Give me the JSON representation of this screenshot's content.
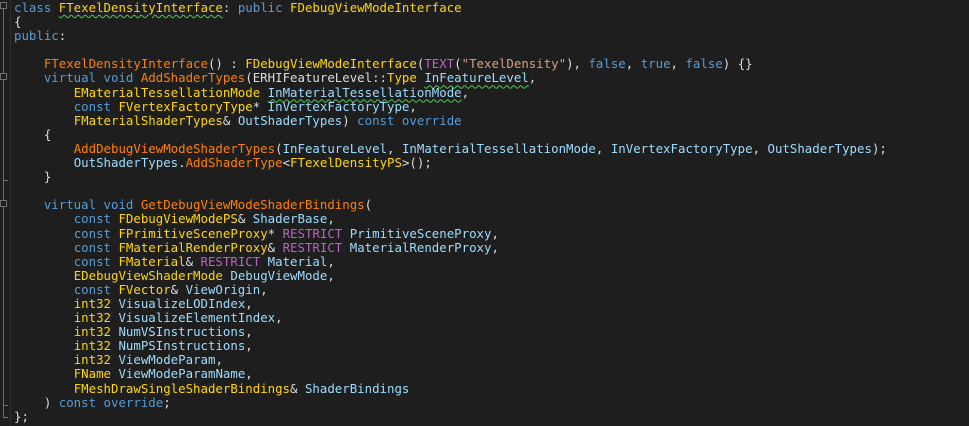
{
  "editor": {
    "lines": [
      [
        {
          "c": "k",
          "t": "class "
        },
        {
          "c": "t",
          "t": "FTexelDensityInterface",
          "sq": "true"
        },
        {
          "c": "pl",
          "t": ": "
        },
        {
          "c": "k",
          "t": "public "
        },
        {
          "c": "t",
          "t": "FDebugViewModeInterface"
        }
      ],
      [
        {
          "c": "pl",
          "t": "{"
        }
      ],
      [
        {
          "c": "k",
          "t": "public"
        },
        {
          "c": "pl",
          "t": ":"
        }
      ],
      [],
      [
        {
          "c": "pl",
          "t": "    "
        },
        {
          "c": "f",
          "t": "FTexelDensityInterface"
        },
        {
          "c": "pl",
          "t": "() : "
        },
        {
          "c": "t",
          "t": "FDebugViewModeInterface"
        },
        {
          "c": "pl",
          "t": "("
        },
        {
          "c": "m",
          "t": "TEXT"
        },
        {
          "c": "pl",
          "t": "("
        },
        {
          "c": "s",
          "t": "\"TexelDensity\""
        },
        {
          "c": "pl",
          "t": "), "
        },
        {
          "c": "k",
          "t": "false"
        },
        {
          "c": "pl",
          "t": ", "
        },
        {
          "c": "k",
          "t": "true"
        },
        {
          "c": "pl",
          "t": ", "
        },
        {
          "c": "k",
          "t": "false"
        },
        {
          "c": "pl",
          "t": ") {}"
        }
      ],
      [
        {
          "c": "pl",
          "t": "    "
        },
        {
          "c": "k",
          "t": "virtual void "
        },
        {
          "c": "f",
          "t": "AddShaderTypes"
        },
        {
          "c": "pl",
          "t": "(ERHIFeatureLevel::"
        },
        {
          "c": "t",
          "t": "Type"
        },
        {
          "c": "pl",
          "t": " "
        },
        {
          "c": "p",
          "t": "InFeatureLevel",
          "sq": "true"
        },
        {
          "c": "pl",
          "t": ","
        }
      ],
      [
        {
          "c": "pl",
          "t": "        "
        },
        {
          "c": "t",
          "t": "EMaterialTessellationMode"
        },
        {
          "c": "pl",
          "t": " "
        },
        {
          "c": "p",
          "t": "InMaterialTessellationMode",
          "sq": "true"
        },
        {
          "c": "pl",
          "t": ","
        }
      ],
      [
        {
          "c": "pl",
          "t": "        "
        },
        {
          "c": "k",
          "t": "const "
        },
        {
          "c": "t",
          "t": "FVertexFactoryType"
        },
        {
          "c": "pl",
          "t": "* "
        },
        {
          "c": "p",
          "t": "InVertexFactoryType"
        },
        {
          "c": "pl",
          "t": ","
        }
      ],
      [
        {
          "c": "pl",
          "t": "        "
        },
        {
          "c": "t",
          "t": "FMaterialShaderTypes"
        },
        {
          "c": "pl",
          "t": "& "
        },
        {
          "c": "p",
          "t": "OutShaderTypes"
        },
        {
          "c": "pl",
          "t": ") "
        },
        {
          "c": "k",
          "t": "const override"
        }
      ],
      [
        {
          "c": "pl",
          "t": "    {"
        }
      ],
      [
        {
          "c": "pl",
          "t": "        "
        },
        {
          "c": "f",
          "t": "AddDebugViewModeShaderTypes"
        },
        {
          "c": "pl",
          "t": "("
        },
        {
          "c": "p",
          "t": "InFeatureLevel"
        },
        {
          "c": "pl",
          "t": ", "
        },
        {
          "c": "p",
          "t": "InMaterialTessellationMode"
        },
        {
          "c": "pl",
          "t": ", "
        },
        {
          "c": "p",
          "t": "InVertexFactoryType"
        },
        {
          "c": "pl",
          "t": ", "
        },
        {
          "c": "p",
          "t": "OutShaderTypes"
        },
        {
          "c": "pl",
          "t": ");"
        }
      ],
      [
        {
          "c": "pl",
          "t": "        "
        },
        {
          "c": "p",
          "t": "OutShaderTypes"
        },
        {
          "c": "pl",
          "t": "."
        },
        {
          "c": "f",
          "t": "AddShaderType"
        },
        {
          "c": "pl",
          "t": "<"
        },
        {
          "c": "t",
          "t": "FTexelDensityPS"
        },
        {
          "c": "pl",
          "t": ">();"
        }
      ],
      [
        {
          "c": "pl",
          "t": "    }"
        }
      ],
      [],
      [
        {
          "c": "pl",
          "t": "    "
        },
        {
          "c": "k",
          "t": "virtual void "
        },
        {
          "c": "f",
          "t": "GetDebugViewModeShaderBindings"
        },
        {
          "c": "pl",
          "t": "("
        }
      ],
      [
        {
          "c": "pl",
          "t": "        "
        },
        {
          "c": "k",
          "t": "const "
        },
        {
          "c": "t",
          "t": "FDebugViewModePS"
        },
        {
          "c": "pl",
          "t": "& "
        },
        {
          "c": "p",
          "t": "ShaderBase"
        },
        {
          "c": "pl",
          "t": ","
        }
      ],
      [
        {
          "c": "pl",
          "t": "        "
        },
        {
          "c": "k",
          "t": "const "
        },
        {
          "c": "t",
          "t": "FPrimitiveSceneProxy"
        },
        {
          "c": "pl",
          "t": "* "
        },
        {
          "c": "m",
          "t": "RESTRICT"
        },
        {
          "c": "pl",
          "t": " "
        },
        {
          "c": "p",
          "t": "PrimitiveSceneProxy"
        },
        {
          "c": "pl",
          "t": ","
        }
      ],
      [
        {
          "c": "pl",
          "t": "        "
        },
        {
          "c": "k",
          "t": "const "
        },
        {
          "c": "t",
          "t": "FMaterialRenderProxy"
        },
        {
          "c": "pl",
          "t": "& "
        },
        {
          "c": "m",
          "t": "RESTRICT"
        },
        {
          "c": "pl",
          "t": " "
        },
        {
          "c": "p",
          "t": "MaterialRenderProxy"
        },
        {
          "c": "pl",
          "t": ","
        }
      ],
      [
        {
          "c": "pl",
          "t": "        "
        },
        {
          "c": "k",
          "t": "const "
        },
        {
          "c": "t",
          "t": "FMaterial"
        },
        {
          "c": "pl",
          "t": "& "
        },
        {
          "c": "m",
          "t": "RESTRICT"
        },
        {
          "c": "pl",
          "t": " "
        },
        {
          "c": "p",
          "t": "Material"
        },
        {
          "c": "pl",
          "t": ","
        }
      ],
      [
        {
          "c": "pl",
          "t": "        "
        },
        {
          "c": "t",
          "t": "EDebugViewShaderMode"
        },
        {
          "c": "pl",
          "t": " "
        },
        {
          "c": "p",
          "t": "DebugViewMode"
        },
        {
          "c": "pl",
          "t": ","
        }
      ],
      [
        {
          "c": "pl",
          "t": "        "
        },
        {
          "c": "k",
          "t": "const "
        },
        {
          "c": "t",
          "t": "FVector"
        },
        {
          "c": "pl",
          "t": "& "
        },
        {
          "c": "p",
          "t": "ViewOrigin"
        },
        {
          "c": "pl",
          "t": ","
        }
      ],
      [
        {
          "c": "pl",
          "t": "        "
        },
        {
          "c": "t",
          "t": "int32"
        },
        {
          "c": "pl",
          "t": " "
        },
        {
          "c": "p",
          "t": "VisualizeLODIndex"
        },
        {
          "c": "pl",
          "t": ","
        }
      ],
      [
        {
          "c": "pl",
          "t": "        "
        },
        {
          "c": "t",
          "t": "int32"
        },
        {
          "c": "pl",
          "t": " "
        },
        {
          "c": "p",
          "t": "VisualizeElementIndex"
        },
        {
          "c": "pl",
          "t": ","
        }
      ],
      [
        {
          "c": "pl",
          "t": "        "
        },
        {
          "c": "t",
          "t": "int32"
        },
        {
          "c": "pl",
          "t": " "
        },
        {
          "c": "p",
          "t": "NumVSInstructions"
        },
        {
          "c": "pl",
          "t": ","
        }
      ],
      [
        {
          "c": "pl",
          "t": "        "
        },
        {
          "c": "t",
          "t": "int32"
        },
        {
          "c": "pl",
          "t": " "
        },
        {
          "c": "p",
          "t": "NumPSInstructions"
        },
        {
          "c": "pl",
          "t": ","
        }
      ],
      [
        {
          "c": "pl",
          "t": "        "
        },
        {
          "c": "t",
          "t": "int32"
        },
        {
          "c": "pl",
          "t": " "
        },
        {
          "c": "p",
          "t": "ViewModeParam"
        },
        {
          "c": "pl",
          "t": ","
        }
      ],
      [
        {
          "c": "pl",
          "t": "        "
        },
        {
          "c": "t",
          "t": "FName"
        },
        {
          "c": "pl",
          "t": " "
        },
        {
          "c": "p",
          "t": "ViewModeParamName"
        },
        {
          "c": "pl",
          "t": ","
        }
      ],
      [
        {
          "c": "pl",
          "t": "        "
        },
        {
          "c": "t",
          "t": "FMeshDrawSingleShaderBindings"
        },
        {
          "c": "pl",
          "t": "& "
        },
        {
          "c": "p",
          "t": "ShaderBindings"
        }
      ],
      [
        {
          "c": "pl",
          "t": "    ) "
        },
        {
          "c": "k",
          "t": "const override"
        },
        {
          "c": "pl",
          "t": ";"
        }
      ],
      [
        {
          "c": "pl",
          "t": "};"
        }
      ]
    ]
  }
}
